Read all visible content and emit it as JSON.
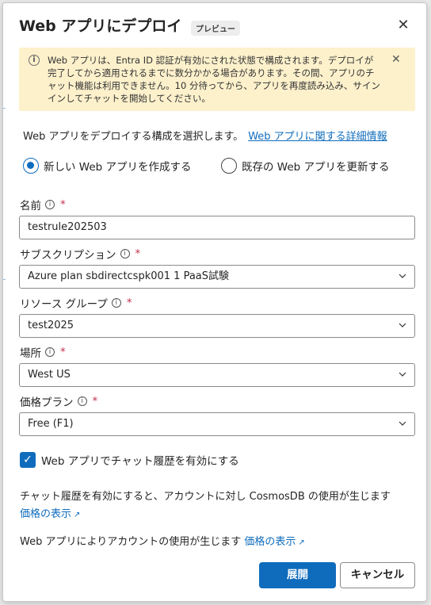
{
  "dialog": {
    "title": "Web アプリにデプロイ",
    "badge": "プレビュー",
    "close_icon": "close-icon"
  },
  "banner": {
    "icon": "info-icon",
    "text": "Web アプリは、Entra ID 認証が有効にされた状態で構成されます。デプロイが完了してから適用されるまでに数分かかる場合があります。その間、アプリのチャット機能は利用できません。10 分待ってから、アプリを再度読み込み、サインインしてチャットを開始してください。",
    "close_icon": "close-icon"
  },
  "intro": {
    "text": "Web アプリをデプロイする構成を選択します。",
    "link": "Web アプリに関する詳細情報"
  },
  "radios": [
    {
      "label": "新しい Web アプリを作成する",
      "selected": true
    },
    {
      "label": "既存の Web アプリを更新する",
      "selected": false
    }
  ],
  "fields": {
    "name": {
      "label": "名前",
      "value": "testrule202503"
    },
    "subscription": {
      "label": "サブスクリプション",
      "value": "Azure plan sbdirectcspk001 1 PaaS試験"
    },
    "resource_group": {
      "label": "リソース グループ",
      "value": "test2025"
    },
    "location": {
      "label": "場所",
      "value": "West US"
    },
    "pricing_plan": {
      "label": "価格プラン",
      "value": "Free (F1)"
    }
  },
  "required_marker": "*",
  "chat_history": {
    "label": "Web アプリでチャット履歴を有効にする",
    "checked": true
  },
  "notes": {
    "cosmos": "チャット履歴を有効にすると、アカウントに対し CosmosDB の使用が生じます",
    "cosmos_link": "価格の表示",
    "webapp": "Web アプリによりアカウントの使用が生じます",
    "webapp_link": "価格の表示"
  },
  "buttons": {
    "deploy": "展開",
    "cancel": "キャンセル"
  },
  "colors": {
    "accent": "#0f6cbd",
    "banner_bg": "#fdf1cc",
    "required": "#c4314b"
  }
}
